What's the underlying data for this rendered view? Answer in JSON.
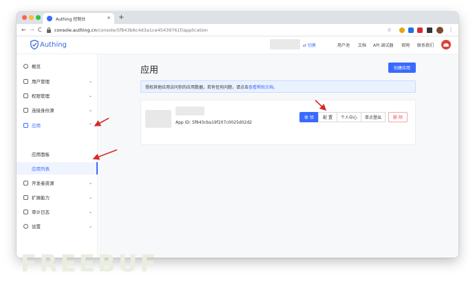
{
  "browser": {
    "tab_title": "Authing 控制台",
    "tab_close": "×",
    "new_tab": "+",
    "url_host": "console.authing.cn",
    "url_path": "/console/5f843b6c4d3a1ce45439761f/application",
    "back": "←",
    "forward": "→",
    "reload": "C",
    "star": "☆",
    "menu": "⋮"
  },
  "header": {
    "logo_text": "Authing",
    "switch_label": "⇄ 切换",
    "nav": [
      "用户池",
      "文档",
      "API 调试器",
      "官网",
      "联系我们"
    ]
  },
  "sidebar": {
    "items": [
      {
        "label": "概览",
        "icon": "dashboard-icon",
        "chevron": ""
      },
      {
        "label": "用户管理",
        "icon": "users-icon",
        "chevron": "⌄"
      },
      {
        "label": "权限管理",
        "icon": "permission-icon",
        "chevron": "⌄"
      },
      {
        "label": "连接身份源",
        "icon": "identity-icon",
        "chevron": "⌄"
      },
      {
        "label": "应用",
        "icon": "app-icon",
        "chevron": "⌃"
      },
      {
        "label": "应用面板",
        "icon": "",
        "chevron": ""
      },
      {
        "label": "应用列表",
        "icon": "",
        "chevron": ""
      },
      {
        "label": "开发者资源",
        "icon": "developer-icon",
        "chevron": "⌄"
      },
      {
        "label": "扩展能力",
        "icon": "extension-icon",
        "chevron": "⌄"
      },
      {
        "label": "审计日志",
        "icon": "audit-icon",
        "chevron": "⌄"
      },
      {
        "label": "设置",
        "icon": "settings-icon",
        "chevron": "⌄"
      }
    ]
  },
  "main": {
    "title": "应用",
    "create_button": "创建应用",
    "notice_text": "授权其他应用访问你的应用数据，若有任何问题，请点击 ",
    "notice_link": "查看帮助文档。",
    "app": {
      "id_label": "App ID: 5f843cba19f207c0025d02d2",
      "buttons": {
        "try": "体 验",
        "config": "配 置",
        "portal": "个人中心",
        "logout": "单点登出",
        "delete": "删 除"
      }
    }
  },
  "watermark": "FREEBUF",
  "colors": {
    "accent": "#396aff",
    "danger": "#e34d59",
    "annotation": "#d62b2b"
  }
}
